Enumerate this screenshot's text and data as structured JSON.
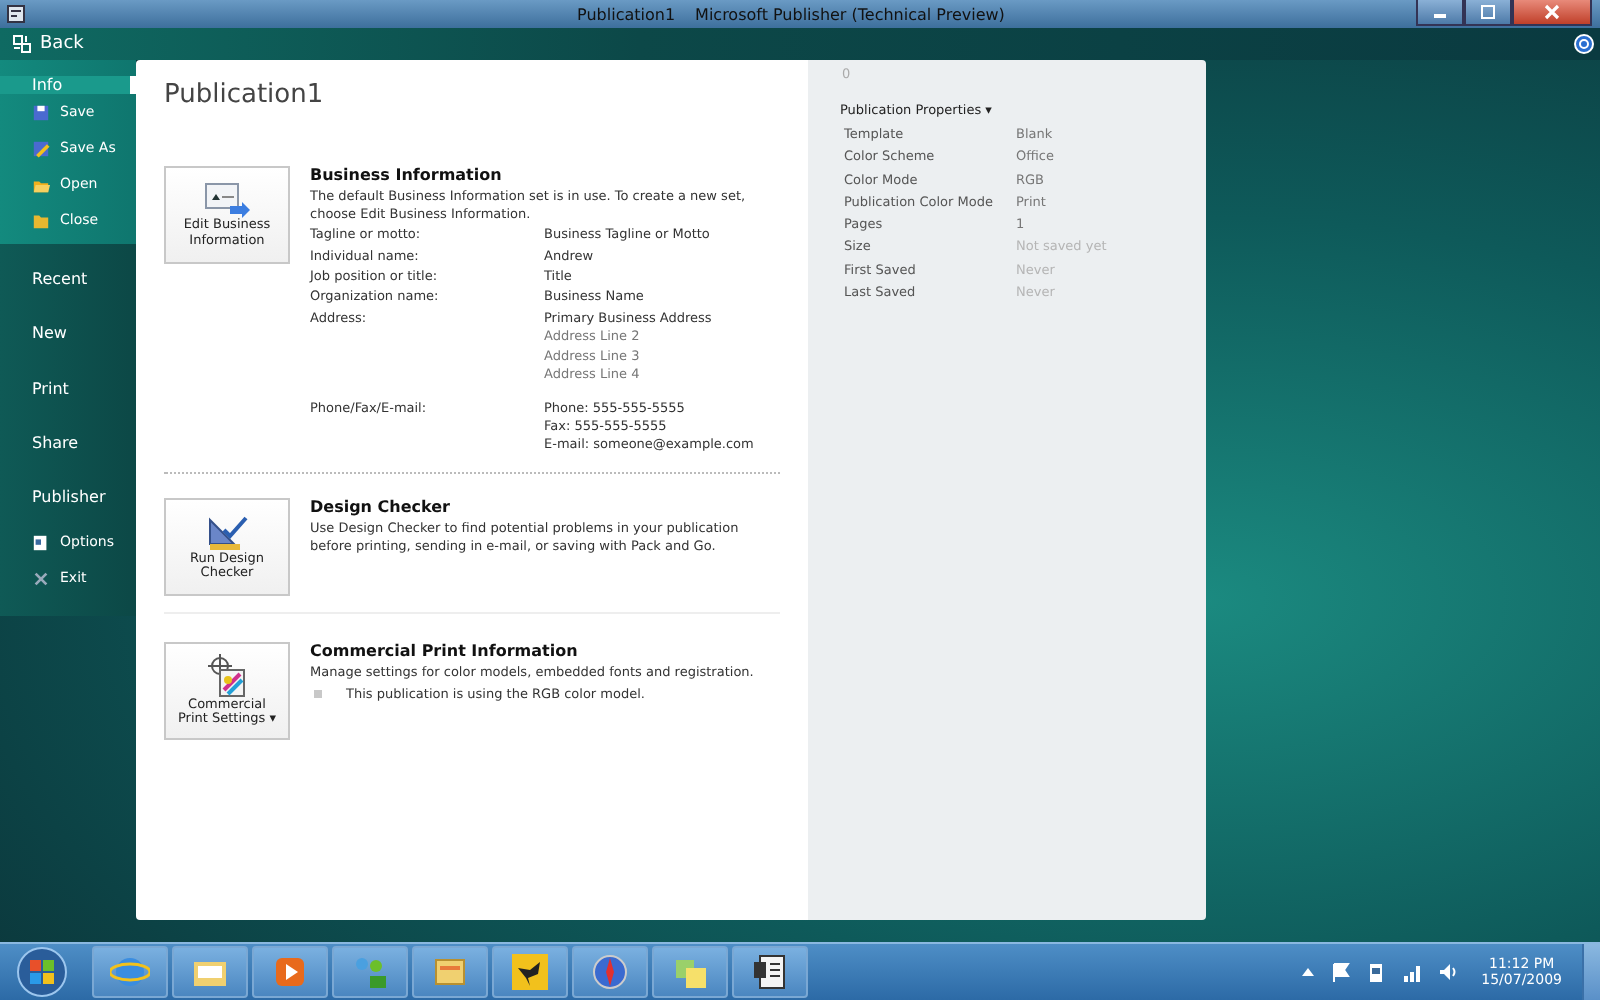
{
  "window": {
    "title": "Publication1",
    "app_name": "Microsoft Publisher (Technical Preview)"
  },
  "back": {
    "label": "Back"
  },
  "nav": {
    "primary": [
      {
        "label": "Info",
        "kind": "main",
        "selected": true
      },
      {
        "label": "Save",
        "kind": "sub",
        "selected": false
      },
      {
        "label": "Save As",
        "kind": "sub",
        "selected": false
      },
      {
        "label": "Open",
        "kind": "sub",
        "selected": false
      },
      {
        "label": "Close",
        "kind": "sub",
        "selected": false
      }
    ],
    "secondary": [
      {
        "label": "Recent",
        "kind": "main",
        "selected": false
      },
      {
        "label": "New",
        "kind": "main",
        "selected": false
      },
      {
        "label": "Print",
        "kind": "main",
        "selected": false
      },
      {
        "label": "Share",
        "kind": "main",
        "selected": false
      },
      {
        "label": "Publisher",
        "kind": "main",
        "selected": false
      },
      {
        "label": "Options",
        "kind": "sub",
        "selected": false
      },
      {
        "label": "Exit",
        "kind": "sub",
        "selected": false
      }
    ]
  },
  "page_title": "Publication1",
  "business": {
    "button": [
      "Edit Business",
      "Information"
    ],
    "title": "Business Information",
    "description": "The default Business Information set is in use. To create a new set, choose Edit Business Information.",
    "fields": [
      {
        "label": "Tagline or motto:",
        "values": [
          {
            "text": "Business Tagline or Motto",
            "dim": false
          }
        ]
      },
      {
        "label": "Individual name:",
        "values": [
          {
            "text": "Andrew",
            "dim": false
          }
        ]
      },
      {
        "label": "Job position or title:",
        "values": [
          {
            "text": "Title",
            "dim": false
          }
        ]
      },
      {
        "label": "Organization name:",
        "values": [
          {
            "text": "Business Name",
            "dim": false
          }
        ]
      },
      {
        "label": "Address:",
        "values": [
          {
            "text": "Primary Business Address",
            "dim": false
          },
          {
            "text": "Address Line 2",
            "dim": true
          },
          {
            "text": "Address Line 3",
            "dim": true
          },
          {
            "text": "Address Line 4",
            "dim": true
          }
        ]
      },
      {
        "label": "Phone/Fax/E-mail:",
        "values": [
          {
            "text": "Phone: 555-555-5555",
            "dim": false
          },
          {
            "text": "Fax: 555-555-5555",
            "dim": false
          },
          {
            "text": "E-mail: someone@example.com",
            "dim": false
          }
        ]
      }
    ]
  },
  "design_checker": {
    "button": [
      "Run Design",
      "Checker"
    ],
    "title": "Design Checker",
    "description": "Use Design Checker to find potential problems in your publication before printing, sending in e-mail, or saving with Pack and Go."
  },
  "commercial_print": {
    "button": [
      "Commercial",
      "Print Settings"
    ],
    "button_caret": "▾",
    "title": "Commercial Print Information",
    "description": "Manage settings for color models, embedded fonts and registration.",
    "bullet": "This publication is using the RGB color model."
  },
  "properties": {
    "status_text": "0",
    "title": "Publication Properties",
    "caret": "▾",
    "rows": [
      {
        "label": "Template",
        "value": "Blank",
        "dim": false
      },
      {
        "label": "Color Scheme",
        "value": "Office",
        "dim": false
      },
      {
        "label": "Color Mode",
        "value": "RGB",
        "dim": false
      },
      {
        "label": "Publication Color Mode",
        "value": "Print",
        "dim": false
      },
      {
        "label": "Pages",
        "value": "1",
        "dim": false
      },
      {
        "label": "Size",
        "value": "Not saved yet",
        "dim": true
      },
      {
        "label": "First Saved",
        "value": "Never",
        "dim": true
      },
      {
        "label": "Last Saved",
        "value": "Never",
        "dim": true
      }
    ]
  },
  "taskbar": {
    "time": "11:12 PM",
    "date": "15/07/2009"
  }
}
